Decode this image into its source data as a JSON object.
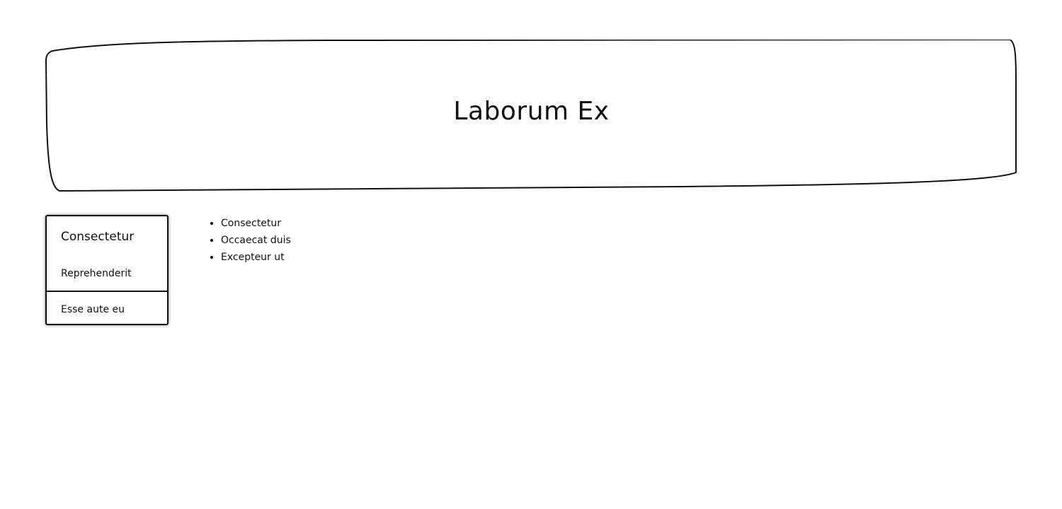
{
  "header": {
    "title": "Laborum Ex"
  },
  "sidebar_card": {
    "title": "Consectetur",
    "link_label": "Reprehenderit",
    "footer_label": "Esse aute eu"
  },
  "list": {
    "items": [
      {
        "label": "Consectetur"
      },
      {
        "label": "Occaecat duis"
      },
      {
        "label": "Excepteur ut"
      }
    ]
  }
}
